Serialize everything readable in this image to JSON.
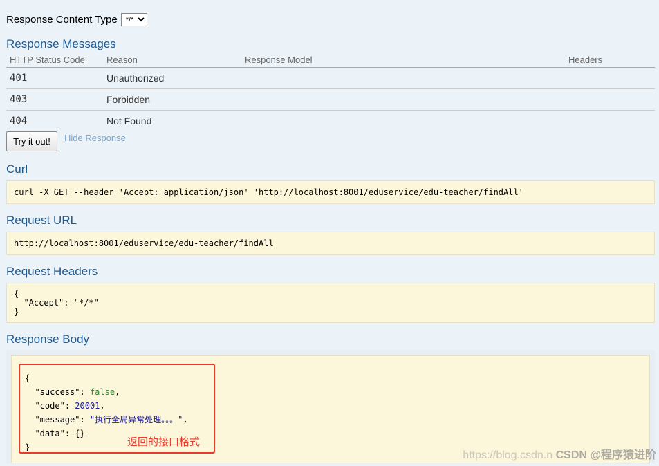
{
  "response_content_type": {
    "label": "Response Content Type",
    "selected": "*/*"
  },
  "response_messages": {
    "title": "Response Messages",
    "columns": [
      "HTTP Status Code",
      "Reason",
      "Response Model",
      "Headers"
    ],
    "rows": [
      {
        "code": "401",
        "reason": "Unauthorized"
      },
      {
        "code": "403",
        "reason": "Forbidden"
      },
      {
        "code": "404",
        "reason": "Not Found"
      }
    ]
  },
  "actions": {
    "try_label": "Try it out!",
    "hide_label": "Hide Response"
  },
  "curl": {
    "title": "Curl",
    "command": "curl -X GET --header 'Accept: application/json' 'http://localhost:8001/eduservice/edu-teacher/findAll'"
  },
  "request_url": {
    "title": "Request URL",
    "value": "http://localhost:8001/eduservice/edu-teacher/findAll"
  },
  "request_headers": {
    "title": "Request Headers",
    "value": "{\n  \"Accept\": \"*/*\"\n}"
  },
  "response_body": {
    "title": "Response Body",
    "open": "{",
    "close": "}",
    "fields": {
      "success_key": "\"success\"",
      "success_val": "false",
      "code_key": "\"code\"",
      "code_val": "20001",
      "message_key": "\"message\"",
      "message_val": "\"执行全局异常处理。。。\"",
      "data_key": "\"data\"",
      "data_val": "{}"
    },
    "annotation": "返回的接口格式",
    "highlight_color": "#e8392a"
  },
  "watermark": {
    "url": "https://blog.csdn.n",
    "brand": "CSDN @程序猿进阶"
  }
}
